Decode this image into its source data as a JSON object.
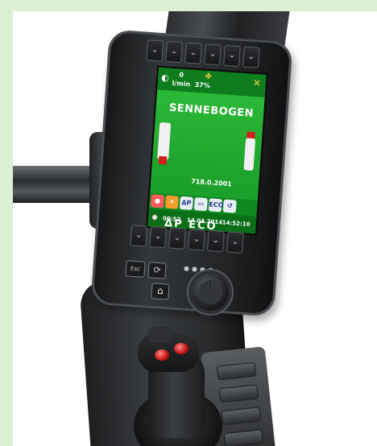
{
  "screen": {
    "topbar": {
      "value_left": "0",
      "unit_left": "l/min",
      "percent": "37%"
    },
    "brand": "SENNEBOGEN",
    "serial": "718.0.2001",
    "iconbar": {
      "icon3": "ΔP",
      "icon5": "ECO"
    },
    "bottombar": {
      "time_left": "00:52",
      "date": "14.03.2014",
      "time_right": "14:52:10"
    }
  },
  "below_screen_icons": "ΔP ECO",
  "hardware": {
    "esc_label": "Esc",
    "softkey_symbol": "⌄",
    "softkey_top_count": 6,
    "softkey_bottom_count": 6
  }
}
